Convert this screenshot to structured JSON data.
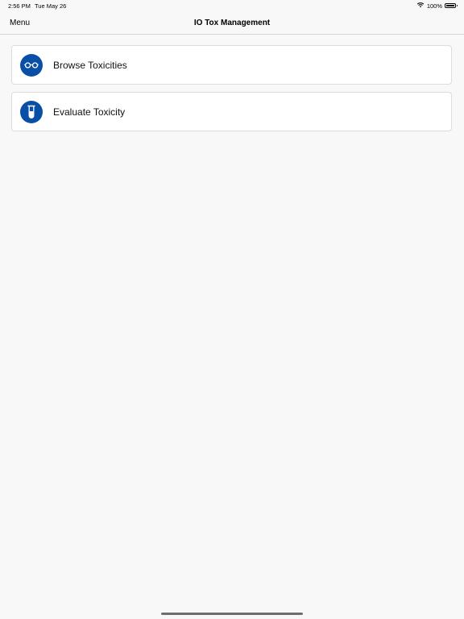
{
  "status_bar": {
    "time": "2:56 PM",
    "date": "Tue May 26",
    "battery_text": "100%",
    "battery_level": 1.0
  },
  "nav": {
    "menu_label": "Menu",
    "title": "IO Tox Management"
  },
  "menu_items": [
    {
      "label": "Browse Toxicities",
      "icon": "glasses-icon"
    },
    {
      "label": "Evaluate Toxicity",
      "icon": "test-tube-icon"
    }
  ],
  "colors": {
    "accent": "#0a4fa6",
    "background": "#f8f8f8",
    "card": "#ffffff"
  }
}
